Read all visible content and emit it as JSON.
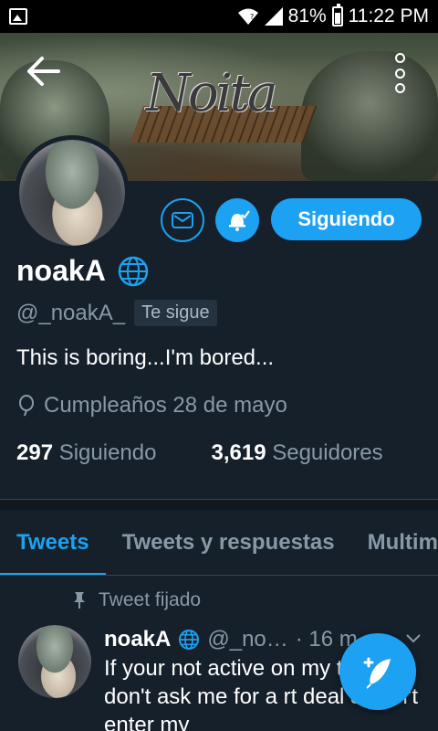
{
  "status_bar": {
    "battery": "81%",
    "time": "11:22 PM"
  },
  "profile": {
    "name": "noakA",
    "handle": "@_noakA_",
    "follows_you": "Te sigue",
    "bio": "This is boring...I'm bored...",
    "birthday": "Cumpleaños 28 de mayo",
    "following_count": "297",
    "following_label": "Siguiendo",
    "followers_count": "3,619",
    "followers_label": "Seguidores"
  },
  "actions": {
    "follow_button": "Siguiendo"
  },
  "tabs": [
    {
      "label": "Tweets",
      "active": true
    },
    {
      "label": "Tweets y respuestas",
      "active": false
    },
    {
      "label": "Multimedia",
      "active": false
    }
  ],
  "tweet": {
    "pinned_label": "Tweet fijado",
    "name": "noakA",
    "handle": "@_no…",
    "time": "· 16 m",
    "text": "If your not active on my twitter don't ask me for a rt deal & don't enter my"
  },
  "colors": {
    "accent": "#1da1f2",
    "background": "#15202b",
    "muted": "#8899a6"
  },
  "icons": {
    "back": "arrow-left-icon",
    "more": "more-vertical-icon",
    "dm": "envelope-icon",
    "notifications": "bell-check-icon",
    "verified_globe": "globe-icon",
    "birthday": "balloon-icon",
    "pin": "pin-icon",
    "compose": "feather-icon"
  }
}
